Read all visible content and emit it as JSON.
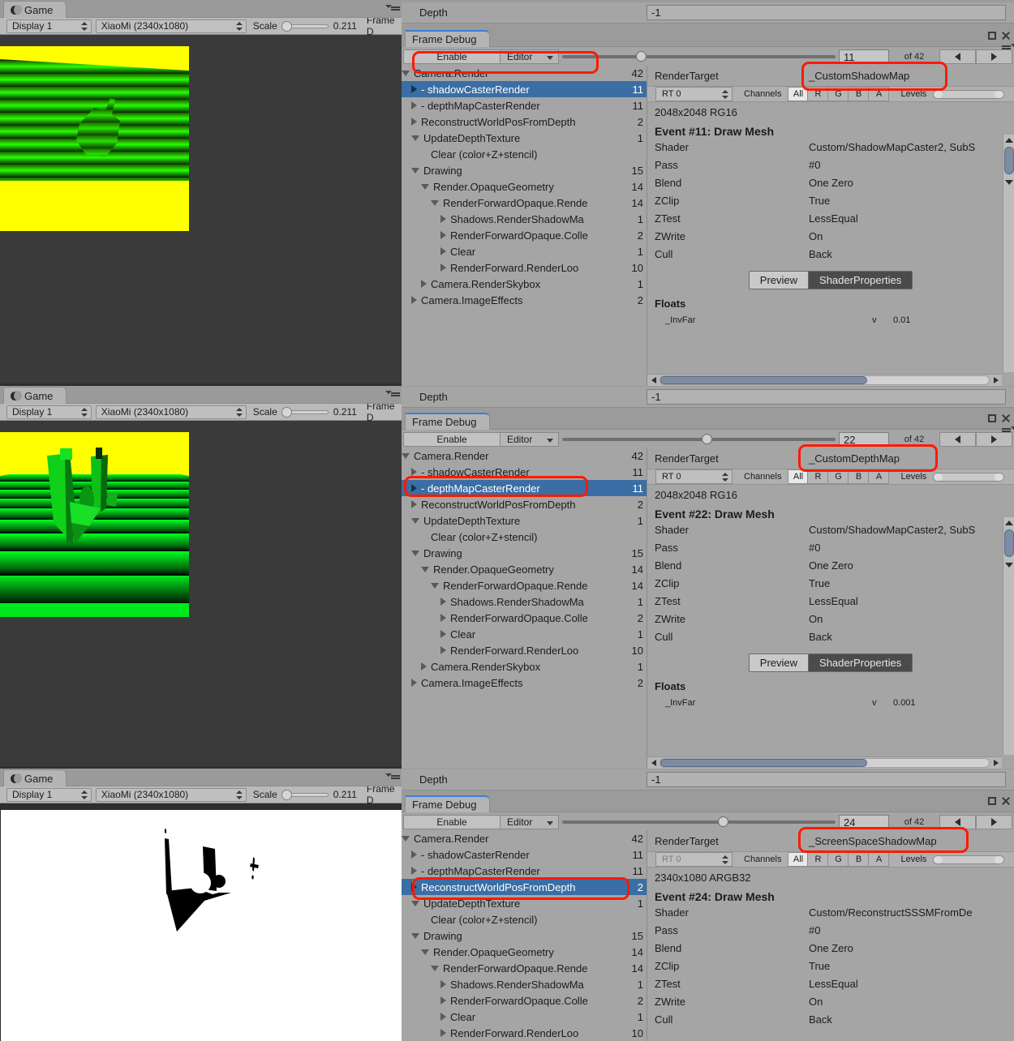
{
  "app": "Unity Editor",
  "game_view": {
    "tab_label": "Game",
    "tab_icon": "game-moon-icon",
    "display_dropdown": "Display 1",
    "resolution_dropdown": "XiaoMi (2340x1080)",
    "scale_label": "Scale",
    "scale_value": "0.211",
    "frame_label": "Frame D"
  },
  "depth_field": {
    "label": "Depth",
    "value": "-1"
  },
  "frame_debug": {
    "tab_label": "Frame Debug",
    "enable_label": "Enable",
    "target_label": "Editor",
    "of_label": "of 42",
    "total_events": 42,
    "render_target_label": "RenderTarget",
    "rt_selector": "RT 0",
    "channels_label": "Channels",
    "channels": [
      "All",
      "R",
      "G",
      "B",
      "A"
    ],
    "channel_selected": "All",
    "levels_label": "Levels",
    "preview_label": "Preview",
    "shader_props_label": "ShaderProperties",
    "floats_header": "Floats",
    "detail_keys": [
      "Shader",
      "Pass",
      "Blend",
      "ZClip",
      "ZTest",
      "ZWrite",
      "Cull"
    ]
  },
  "panels": [
    {
      "id": "panel-1",
      "event_index": "11",
      "render_target": "_CustomShadowMap",
      "rt_format": "2048x2048 RG16",
      "event_title": "Event #11: Draw Mesh",
      "slider_pct": 27,
      "details": {
        "Shader": "Custom/ShadowMapCaster2, SubS",
        "Pass": "#0",
        "Blend": "One Zero",
        "ZClip": "True",
        "ZTest": "LessEqual",
        "ZWrite": "On",
        "Cull": "Back"
      },
      "floats": [
        {
          "name": "_InvFar",
          "flag": "v",
          "value": "0.01"
        }
      ],
      "tree": [
        {
          "label": "Camera.Render",
          "count": "42",
          "indent": 0,
          "arrow": "down",
          "dash": false,
          "selected": false
        },
        {
          "label": "- shadowCasterRender",
          "count": "11",
          "indent": 1,
          "arrow": "right",
          "dash": true,
          "selected": true
        },
        {
          "label": "- depthMapCasterRender",
          "count": "11",
          "indent": 1,
          "arrow": "right",
          "dash": true,
          "selected": false
        },
        {
          "label": "ReconstructWorldPosFromDepth",
          "count": "2",
          "indent": 1,
          "arrow": "right",
          "dash": false,
          "selected": false
        },
        {
          "label": "UpdateDepthTexture",
          "count": "1",
          "indent": 1,
          "arrow": "down",
          "dash": false,
          "selected": false
        },
        {
          "label": "Clear (color+Z+stencil)",
          "count": "",
          "indent": 2,
          "arrow": "none",
          "dash": false,
          "selected": false
        },
        {
          "label": "Drawing",
          "count": "15",
          "indent": 1,
          "arrow": "down",
          "dash": false,
          "selected": false
        },
        {
          "label": "Render.OpaqueGeometry",
          "count": "14",
          "indent": 2,
          "arrow": "down",
          "dash": false,
          "selected": false
        },
        {
          "label": "RenderForwardOpaque.Rende",
          "count": "14",
          "indent": 3,
          "arrow": "down",
          "dash": false,
          "selected": false
        },
        {
          "label": "Shadows.RenderShadowMa",
          "count": "1",
          "indent": 4,
          "arrow": "right",
          "dash": false,
          "selected": false
        },
        {
          "label": "RenderForwardOpaque.Colle",
          "count": "2",
          "indent": 4,
          "arrow": "right",
          "dash": false,
          "selected": false
        },
        {
          "label": "Clear",
          "count": "1",
          "indent": 4,
          "arrow": "right",
          "dash": false,
          "selected": false
        },
        {
          "label": "RenderForward.RenderLoo",
          "count": "10",
          "indent": 4,
          "arrow": "right",
          "dash": false,
          "selected": false
        },
        {
          "label": "Camera.RenderSkybox",
          "count": "1",
          "indent": 2,
          "arrow": "right",
          "dash": false,
          "selected": false
        },
        {
          "label": "Camera.ImageEffects",
          "count": "2",
          "indent": 1,
          "arrow": "right",
          "dash": false,
          "selected": false
        }
      ]
    },
    {
      "id": "panel-2",
      "event_index": "22",
      "render_target": "_CustomDepthMap",
      "rt_format": "2048x2048 RG16",
      "event_title": "Event #22: Draw Mesh",
      "slider_pct": 51,
      "details": {
        "Shader": "Custom/ShadowMapCaster2, SubS",
        "Pass": "#0",
        "Blend": "One Zero",
        "ZClip": "True",
        "ZTest": "LessEqual",
        "ZWrite": "On",
        "Cull": "Back"
      },
      "floats": [
        {
          "name": "_InvFar",
          "flag": "v",
          "value": "0.001"
        }
      ],
      "tree": [
        {
          "label": "Camera.Render",
          "count": "42",
          "indent": 0,
          "arrow": "down",
          "dash": false,
          "selected": false
        },
        {
          "label": "- shadowCasterRender",
          "count": "11",
          "indent": 1,
          "arrow": "right",
          "dash": true,
          "selected": false
        },
        {
          "label": "- depthMapCasterRender",
          "count": "11",
          "indent": 1,
          "arrow": "right",
          "dash": true,
          "selected": true
        },
        {
          "label": "ReconstructWorldPosFromDepth",
          "count": "2",
          "indent": 1,
          "arrow": "right",
          "dash": false,
          "selected": false
        },
        {
          "label": "UpdateDepthTexture",
          "count": "1",
          "indent": 1,
          "arrow": "down",
          "dash": false,
          "selected": false
        },
        {
          "label": "Clear (color+Z+stencil)",
          "count": "",
          "indent": 2,
          "arrow": "none",
          "dash": false,
          "selected": false
        },
        {
          "label": "Drawing",
          "count": "15",
          "indent": 1,
          "arrow": "down",
          "dash": false,
          "selected": false
        },
        {
          "label": "Render.OpaqueGeometry",
          "count": "14",
          "indent": 2,
          "arrow": "down",
          "dash": false,
          "selected": false
        },
        {
          "label": "RenderForwardOpaque.Rende",
          "count": "14",
          "indent": 3,
          "arrow": "down",
          "dash": false,
          "selected": false
        },
        {
          "label": "Shadows.RenderShadowMa",
          "count": "1",
          "indent": 4,
          "arrow": "right",
          "dash": false,
          "selected": false
        },
        {
          "label": "RenderForwardOpaque.Colle",
          "count": "2",
          "indent": 4,
          "arrow": "right",
          "dash": false,
          "selected": false
        },
        {
          "label": "Clear",
          "count": "1",
          "indent": 4,
          "arrow": "right",
          "dash": false,
          "selected": false
        },
        {
          "label": "RenderForward.RenderLoo",
          "count": "10",
          "indent": 4,
          "arrow": "right",
          "dash": false,
          "selected": false
        },
        {
          "label": "Camera.RenderSkybox",
          "count": "1",
          "indent": 2,
          "arrow": "right",
          "dash": false,
          "selected": false
        },
        {
          "label": "Camera.ImageEffects",
          "count": "2",
          "indent": 1,
          "arrow": "right",
          "dash": false,
          "selected": false
        }
      ]
    },
    {
      "id": "panel-3",
      "event_index": "24",
      "render_target": "_ScreenSpaceShadowMap",
      "rt_format": "2340x1080 ARGB32",
      "event_title": "Event #24: Draw Mesh",
      "slider_pct": 57,
      "details": {
        "Shader": "Custom/ReconstructSSSMFromDe",
        "Pass": "#0",
        "Blend": "One Zero",
        "ZClip": "True",
        "ZTest": "LessEqual",
        "ZWrite": "On",
        "Cull": "Back"
      },
      "floats": [],
      "tree": [
        {
          "label": "Camera.Render",
          "count": "42",
          "indent": 0,
          "arrow": "down",
          "dash": false,
          "selected": false
        },
        {
          "label": "- shadowCasterRender",
          "count": "11",
          "indent": 1,
          "arrow": "right",
          "dash": true,
          "selected": false
        },
        {
          "label": "- depthMapCasterRender",
          "count": "11",
          "indent": 1,
          "arrow": "right",
          "dash": true,
          "selected": false
        },
        {
          "label": "ReconstructWorldPosFromDepth",
          "count": "2",
          "indent": 1,
          "arrow": "right",
          "dash": false,
          "selected": true
        },
        {
          "label": "UpdateDepthTexture",
          "count": "1",
          "indent": 1,
          "arrow": "down",
          "dash": false,
          "selected": false
        },
        {
          "label": "Clear (color+Z+stencil)",
          "count": "",
          "indent": 2,
          "arrow": "none",
          "dash": false,
          "selected": false
        },
        {
          "label": "Drawing",
          "count": "15",
          "indent": 1,
          "arrow": "down",
          "dash": false,
          "selected": false
        },
        {
          "label": "Render.OpaqueGeometry",
          "count": "14",
          "indent": 2,
          "arrow": "down",
          "dash": false,
          "selected": false
        },
        {
          "label": "RenderForwardOpaque.Rende",
          "count": "14",
          "indent": 3,
          "arrow": "down",
          "dash": false,
          "selected": false
        },
        {
          "label": "Shadows.RenderShadowMa",
          "count": "1",
          "indent": 4,
          "arrow": "right",
          "dash": false,
          "selected": false
        },
        {
          "label": "RenderForwardOpaque.Colle",
          "count": "2",
          "indent": 4,
          "arrow": "right",
          "dash": false,
          "selected": false
        },
        {
          "label": "Clear",
          "count": "1",
          "indent": 4,
          "arrow": "right",
          "dash": false,
          "selected": false
        },
        {
          "label": "RenderForward.RenderLoo",
          "count": "10",
          "indent": 4,
          "arrow": "right",
          "dash": false,
          "selected": false
        }
      ]
    }
  ],
  "colors": {
    "highlight": "#ff1a00",
    "selection": "#3a6ea5",
    "panel_bg": "#a5a5a5",
    "canvas_bg": "#3a3a3a"
  }
}
